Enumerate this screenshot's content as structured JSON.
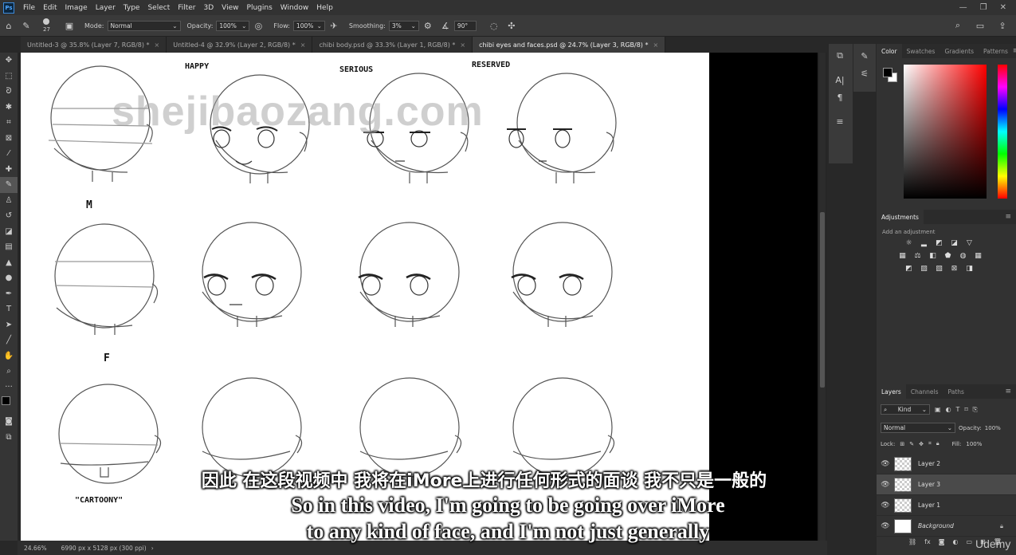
{
  "app": {
    "logo": "Ps"
  },
  "menubar": {
    "items": [
      "File",
      "Edit",
      "Image",
      "Layer",
      "Type",
      "Select",
      "Filter",
      "3D",
      "View",
      "Plugins",
      "Window",
      "Help"
    ]
  },
  "options": {
    "brush_size": "27",
    "mode_label": "Mode:",
    "mode_value": "Normal",
    "opacity_label": "Opacity:",
    "opacity_value": "100%",
    "flow_label": "Flow:",
    "flow_value": "100%",
    "smoothing_label": "Smoothing:",
    "smoothing_value": "3%",
    "angle_value": "90°"
  },
  "tabs": [
    {
      "label": "Untitled-3 @ 35.8% (Layer 7, RGB/8) *"
    },
    {
      "label": "Untitled-4 @ 32.9% (Layer 2, RGB/8) *"
    },
    {
      "label": "chibi body.psd @ 33.3% (Layer 1, RGB/8) *"
    },
    {
      "label": "chibi eyes and faces.psd @ 24.7% (Layer 3, RGB/8) *"
    }
  ],
  "canvas": {
    "labels": [
      "HAPPY",
      "SERIOUS",
      "RESERVED",
      "M",
      "F",
      "\"CARTOONY\""
    ],
    "watermark": "shejibaozang.com"
  },
  "status": {
    "zoom": "24.66%",
    "doc_info": "6990 px x 5128 px (300 ppi)"
  },
  "color_panel": {
    "tabs": [
      "Color",
      "Swatches",
      "Gradients",
      "Patterns"
    ],
    "foreground": "#000000",
    "background": "#ffffff",
    "hue_color": "#ff0000"
  },
  "adjustments": {
    "title": "Adjustments",
    "hint": "Add an adjustment"
  },
  "layers_panel": {
    "tabs": [
      "Layers",
      "Channels",
      "Paths"
    ],
    "filter_label": "Kind",
    "blend_mode": "Normal",
    "opacity_label": "Opacity:",
    "opacity_value": "100%",
    "lock_label": "Lock:",
    "fill_label": "Fill:",
    "fill_value": "100%",
    "layers": [
      {
        "name": "Layer 2",
        "active": false
      },
      {
        "name": "Layer 3",
        "active": true
      },
      {
        "name": "Layer 1",
        "active": false
      },
      {
        "name": "Background",
        "active": false
      }
    ]
  },
  "subtitles": {
    "chinese": "因此 在这段视频中 我将在iMore上进行任何形式的面谈 我不只是一般的",
    "english_line1": "So in this video, I'm going to be going over iMore",
    "english_line2": "to any kind of face, and I'm not just generally",
    "brand": "Udemy"
  }
}
